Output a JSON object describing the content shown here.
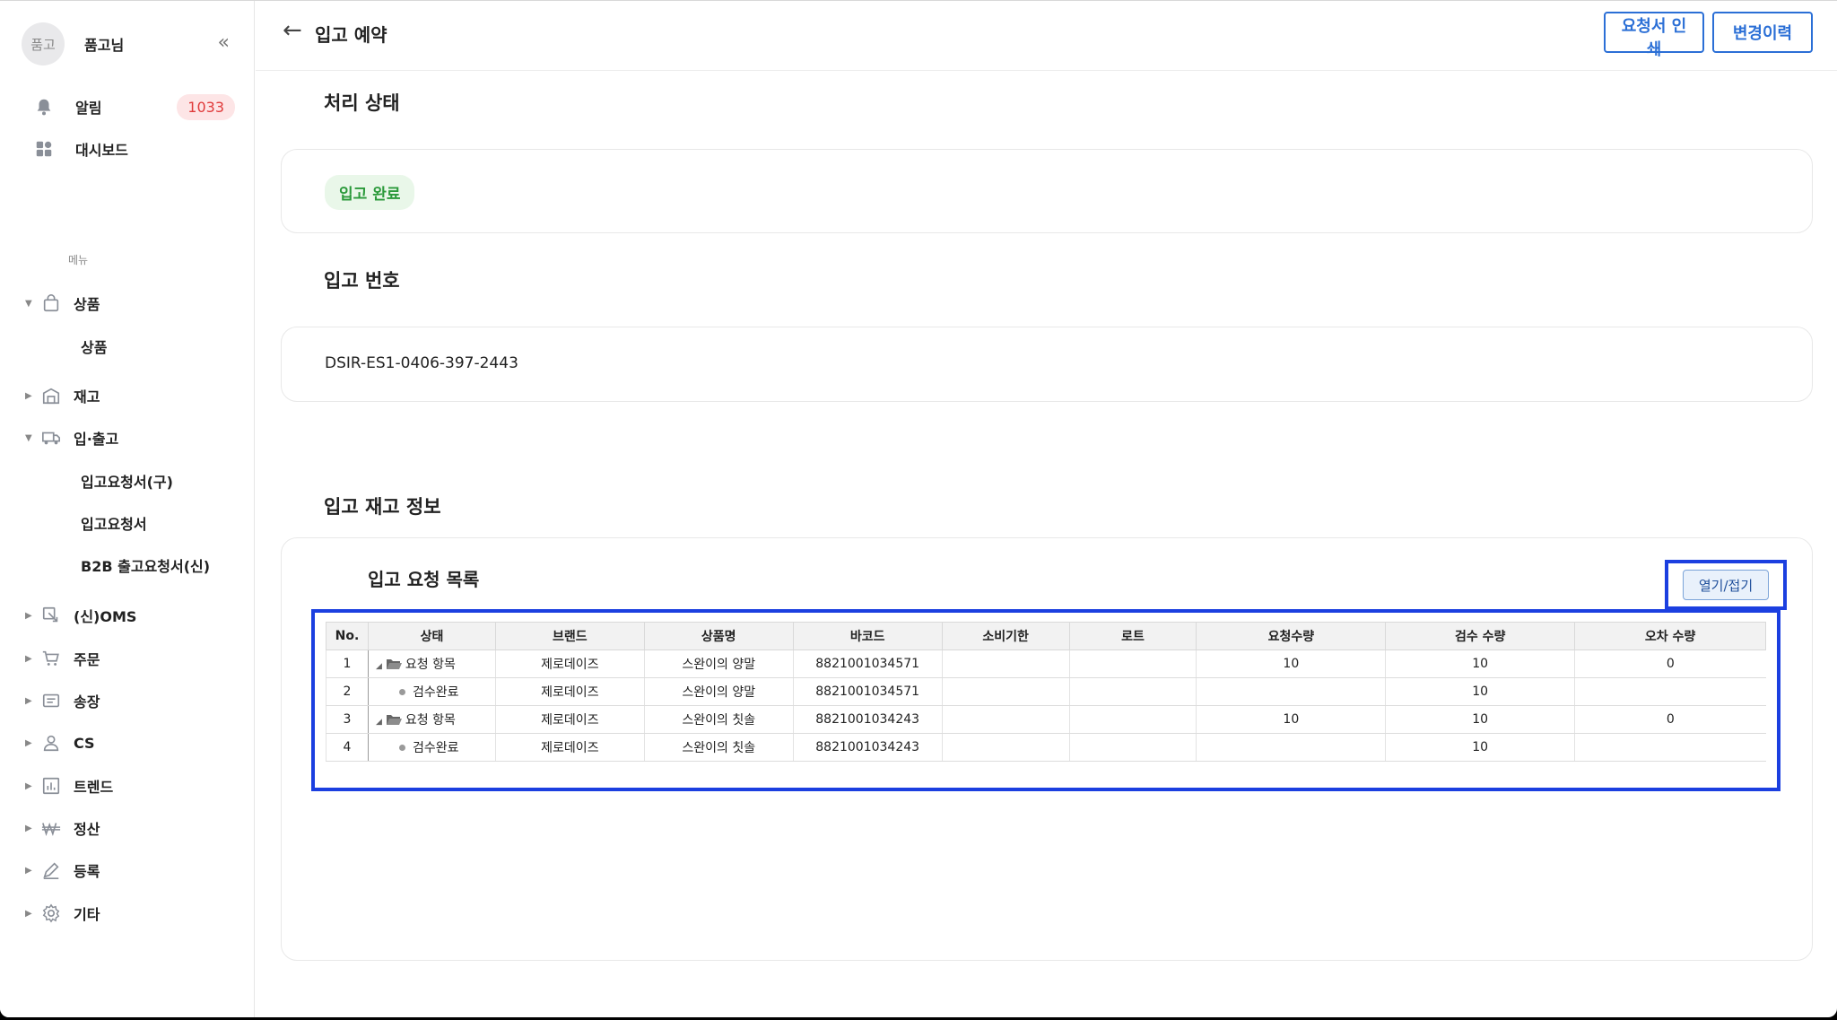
{
  "profile": {
    "avatar_text": "품고",
    "name": "품고님"
  },
  "top_menu": [
    {
      "label": "알림",
      "icon": "bell-icon",
      "badge": "1033"
    },
    {
      "label": "대시보드",
      "icon": "dashboard-icon"
    }
  ],
  "menu_section_label": "메뉴",
  "nav": {
    "product": {
      "label": "상품",
      "sub": [
        "상품"
      ]
    },
    "stock": {
      "label": "재고"
    },
    "inout": {
      "label": "입·출고",
      "sub": [
        "입고요청서(구)",
        "입고요청서",
        "B2B 출고요청서(신)"
      ]
    },
    "oms": {
      "label": "(신)OMS"
    },
    "order": {
      "label": "주문"
    },
    "invoice": {
      "label": "송장"
    },
    "cs": {
      "label": "CS"
    },
    "trend": {
      "label": "트렌드"
    },
    "settle": {
      "label": "정산"
    },
    "register": {
      "label": "등록"
    },
    "etc": {
      "label": "기타"
    }
  },
  "header": {
    "title": "입고 예약",
    "print_button": "요청서 인쇄",
    "history_button": "변경이력"
  },
  "sections": {
    "status_title": "처리 상태",
    "status_value": "입고 완료",
    "number_title": "입고 번호",
    "number_value": "DSIR-ES1-0406-397-2443",
    "stock_title": "입고 재고 정보",
    "list_title": "입고 요청 목록",
    "toggle_button": "열기/접기"
  },
  "colors": {
    "accent": "#2b6fd6",
    "highlight_box": "#1b3fe0",
    "status_green": "#2b9a3b",
    "badge_red": "#e03b3b"
  },
  "table": {
    "columns": [
      "No.",
      "상태",
      "브랜드",
      "상품명",
      "바코드",
      "소비기한",
      "로트",
      "요청수량",
      "검수 수량",
      "오차 수량"
    ],
    "rows": [
      {
        "no": "1",
        "status": "요청 항목",
        "type": "parent",
        "brand": "제로데이즈",
        "product": "스완이의 양말",
        "barcode": "8821001034571",
        "expiry": "",
        "lot": "",
        "req_qty": "10",
        "insp_qty": "10",
        "diff_qty": "0"
      },
      {
        "no": "2",
        "status": "검수완료",
        "type": "child",
        "brand": "제로데이즈",
        "product": "스완이의 양말",
        "barcode": "8821001034571",
        "expiry": "",
        "lot": "",
        "req_qty": "",
        "insp_qty": "10",
        "diff_qty": ""
      },
      {
        "no": "3",
        "status": "요청 항목",
        "type": "parent",
        "brand": "제로데이즈",
        "product": "스완이의 칫솔",
        "barcode": "8821001034243",
        "expiry": "",
        "lot": "",
        "req_qty": "10",
        "insp_qty": "10",
        "diff_qty": "0"
      },
      {
        "no": "4",
        "status": "검수완료",
        "type": "child",
        "brand": "제로데이즈",
        "product": "스완이의 칫솔",
        "barcode": "8821001034243",
        "expiry": "",
        "lot": "",
        "req_qty": "",
        "insp_qty": "10",
        "diff_qty": ""
      }
    ]
  }
}
